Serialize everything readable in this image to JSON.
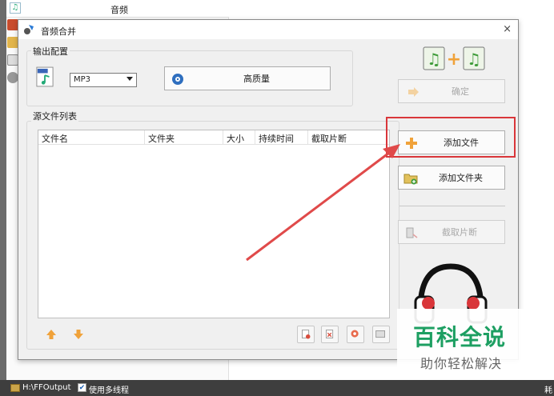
{
  "background": {
    "top_item_label": "音频"
  },
  "dialog": {
    "title": "音频合并",
    "close_glyph": "×",
    "output_config": {
      "group_label": "输出配置",
      "format_value": "MP3",
      "quality_label": "高质量"
    },
    "source_list": {
      "group_label": "源文件列表",
      "columns": [
        "文件名",
        "文件夹",
        "大小",
        "持续时间",
        "截取片断"
      ]
    },
    "right_panel": {
      "confirm_label": "确定",
      "add_file_label": "添加文件",
      "add_folder_label": "添加文件夹",
      "clip_label": "截取片断"
    }
  },
  "status_bar": {
    "output_path": "H:\\FFOutput",
    "multithread_checked": true,
    "multithread_label": "使用多线程",
    "right_fragment": "耗"
  },
  "watermark": {
    "title": "百科全说",
    "subtitle": "助你轻松解决"
  },
  "colors": {
    "highlight_border": "#d9363a",
    "arrow": "#e04a4a",
    "watermark_title": "#1d9f62",
    "accent_orange": "#f0a23a"
  }
}
